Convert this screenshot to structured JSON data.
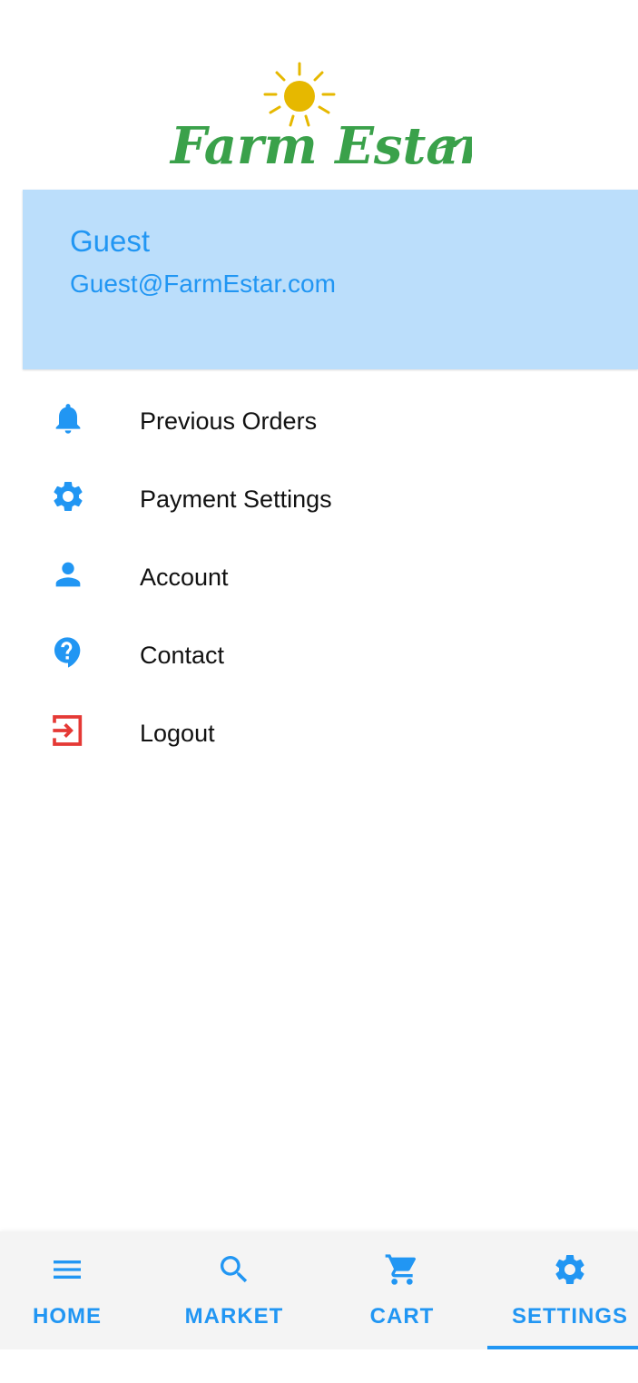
{
  "brand": {
    "logo_text": "Farm Estar",
    "logo_green": "#3aa14a",
    "sun_yellow": "#e6b800"
  },
  "user": {
    "name": "Guest",
    "email": "Guest@FarmEstar.com"
  },
  "menu": {
    "items": [
      {
        "label": "Previous Orders",
        "icon": "bell-icon"
      },
      {
        "label": "Payment Settings",
        "icon": "gear-icon"
      },
      {
        "label": "Account",
        "icon": "person-icon"
      },
      {
        "label": "Contact",
        "icon": "help-icon"
      },
      {
        "label": "Logout",
        "icon": "logout-icon"
      }
    ]
  },
  "bottom_nav": {
    "active": "SETTINGS",
    "items": [
      {
        "label": "HOME",
        "icon": "menu-icon"
      },
      {
        "label": "MARKET",
        "icon": "search-icon"
      },
      {
        "label": "CART",
        "icon": "cart-icon"
      },
      {
        "label": "SETTINGS",
        "icon": "gear-icon"
      }
    ]
  },
  "colors": {
    "accent": "#2196f3",
    "card_bg": "#bbdefb",
    "logout_red": "#e53935"
  }
}
